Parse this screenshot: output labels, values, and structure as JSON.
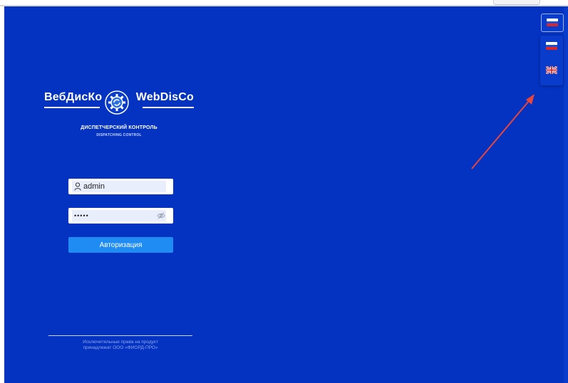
{
  "logo": {
    "text_ru": "ВебДисКо",
    "text_en": "WebDisCo",
    "subtitle_ru": "ДИСПЕТЧЕРСКИЙ КОНТРОЛЬ",
    "subtitle_en": "DISPATCHING CONTROL"
  },
  "login": {
    "username_value": "admin",
    "password_value": "•••••",
    "submit_label": "Авторизация"
  },
  "footer": {
    "line1": "Исключительные права на продукт",
    "line2": "принадлежат ООО «ФИОРД-ПРО»"
  },
  "language": {
    "current": "ru-flag-icon",
    "options": [
      "ru-flag-icon",
      "uk-flag-icon"
    ]
  },
  "colors": {
    "background": "#0433c2",
    "button": "#1f8cf4",
    "arrow": "#e8453c"
  }
}
